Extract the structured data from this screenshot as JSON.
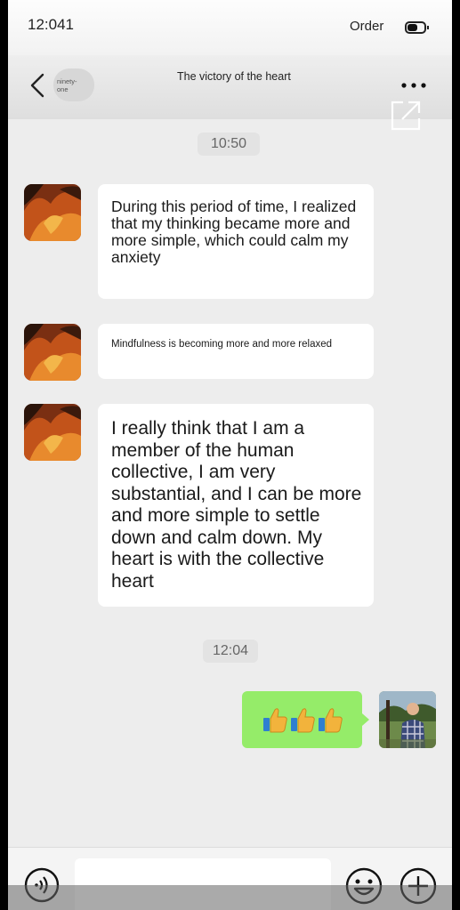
{
  "status": {
    "time": "12:041",
    "right_label": "Order"
  },
  "header": {
    "contact_tag": "ninety-one",
    "title": "The victory of the heart",
    "icons": [
      "back-arrow-icon",
      "more-dots-icon",
      "share-icon"
    ]
  },
  "messages": [
    {
      "type": "time",
      "text": "10:50"
    },
    {
      "type": "incoming",
      "text": "During this period of time, I realized that my thinking became more and more simple, which could calm my anxiety"
    },
    {
      "type": "incoming",
      "text": "Mindfulness is becoming more and more relaxed"
    },
    {
      "type": "incoming",
      "text": "I really think that I am a member of the human collective, I am very substantial, and I can be more and more simple to settle down and calm down. My heart is with the collective heart"
    },
    {
      "type": "time",
      "text": "12:04"
    },
    {
      "type": "outgoing",
      "content": "three thumbs-up emoji"
    }
  ],
  "input_bar": {
    "value": "",
    "icons": [
      "voice-icon",
      "emoji-icon",
      "plus-icon"
    ]
  },
  "colors": {
    "screen_bg": "#ededed",
    "incoming_bubble": "#ffffff",
    "outgoing_bubble": "#95ec69"
  }
}
